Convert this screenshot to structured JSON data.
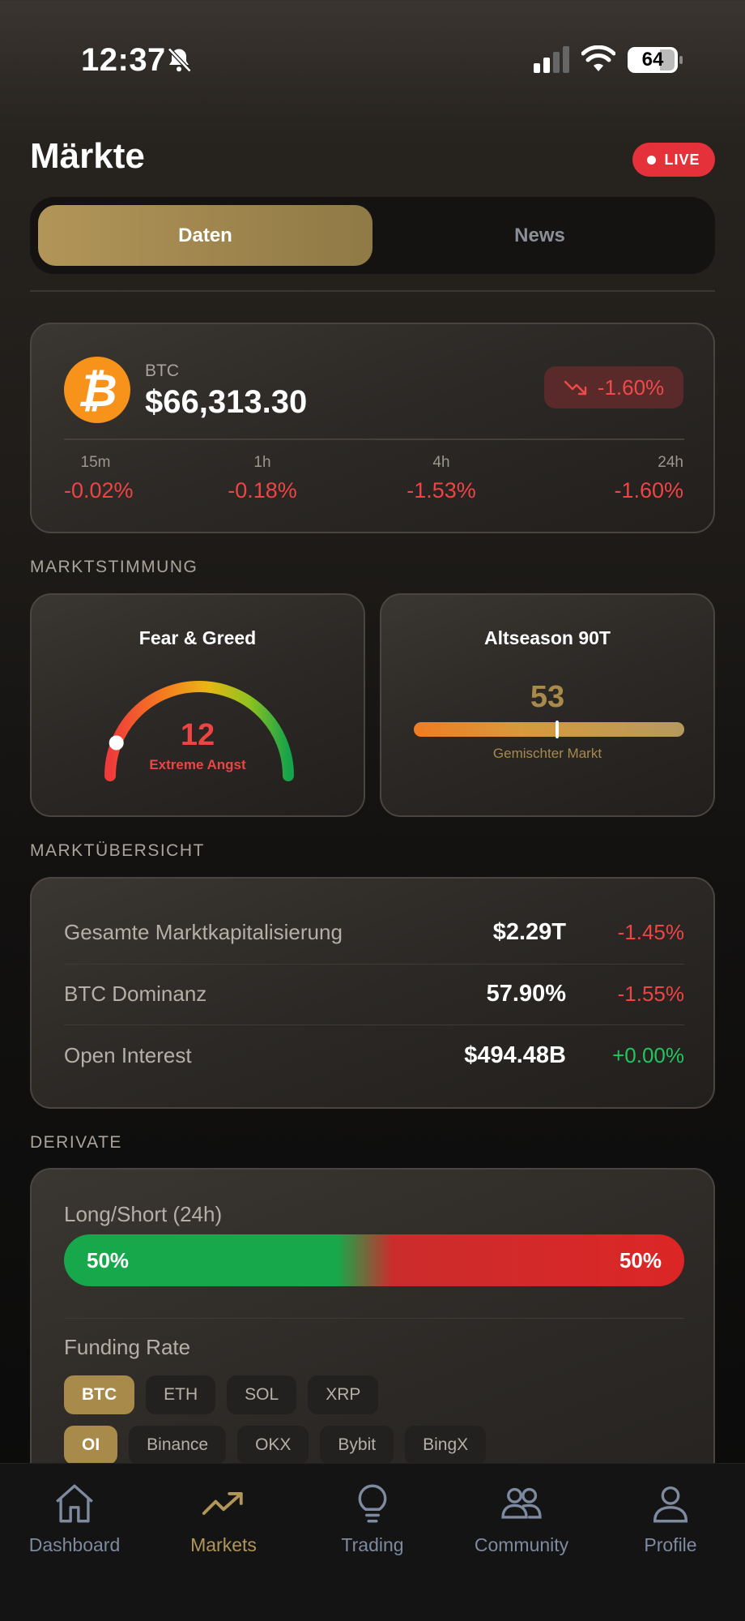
{
  "status_bar": {
    "time": "12:37",
    "battery": "64"
  },
  "header": {
    "title": "Märkte",
    "live_label": "LIVE"
  },
  "tabs": [
    {
      "label": "Daten",
      "active": true
    },
    {
      "label": "News",
      "active": false
    }
  ],
  "btc": {
    "symbol": "BTC",
    "price": "$66,313.30",
    "change": "-1.60%",
    "timeframes": [
      {
        "label": "15m",
        "value": "-0.02%"
      },
      {
        "label": "1h",
        "value": "-0.18%"
      },
      {
        "label": "4h",
        "value": "-1.53%"
      },
      {
        "label": "24h",
        "value": "-1.60%"
      }
    ]
  },
  "sentiment": {
    "section_label": "MARKTSTIMMUNG",
    "fear_greed": {
      "title": "Fear & Greed",
      "value": "12",
      "label": "Extreme Angst",
      "level": 0.12
    },
    "altseason": {
      "title": "Altseason 90T",
      "value": "53",
      "label": "Gemischter Markt",
      "level": 0.53
    }
  },
  "overview": {
    "section_label": "MARKTÜBERSICHT",
    "rows": [
      {
        "name": "Gesamte Marktkapitalisierung",
        "value": "$2.29T",
        "change": "-1.45%",
        "direction": "down"
      },
      {
        "name": "BTC Dominanz",
        "value": "57.90%",
        "change": "-1.55%",
        "direction": "down"
      },
      {
        "name": "Open Interest",
        "value": "$494.48B",
        "change": "+0.00%",
        "direction": "up"
      }
    ]
  },
  "derivatives": {
    "section_label": "DERIVATE",
    "long_short_title": "Long/Short (24h)",
    "long_pct": "50%",
    "short_pct": "50%",
    "funding_title": "Funding Rate",
    "coin_chips": [
      {
        "label": "BTC",
        "active": true
      },
      {
        "label": "ETH",
        "active": false
      },
      {
        "label": "SOL",
        "active": false
      },
      {
        "label": "XRP",
        "active": false
      }
    ],
    "exchange_chips": [
      {
        "label": "OI",
        "active": true
      },
      {
        "label": "Binance",
        "active": false
      },
      {
        "label": "OKX",
        "active": false
      },
      {
        "label": "Bybit",
        "active": false
      },
      {
        "label": "BingX",
        "active": false
      }
    ]
  },
  "nav": [
    {
      "label": "Dashboard",
      "icon": "home-icon",
      "active": false
    },
    {
      "label": "Markets",
      "icon": "trending-up-icon",
      "active": true
    },
    {
      "label": "Trading",
      "icon": "lightbulb-icon",
      "active": false
    },
    {
      "label": "Community",
      "icon": "users-icon",
      "active": false
    },
    {
      "label": "Profile",
      "icon": "user-icon",
      "active": false
    }
  ],
  "colors": {
    "accent": "#b29558",
    "negative": "#ef4444",
    "positive": "#22c55e",
    "live": "#e5323a",
    "bitcoin": "#f7931a"
  }
}
